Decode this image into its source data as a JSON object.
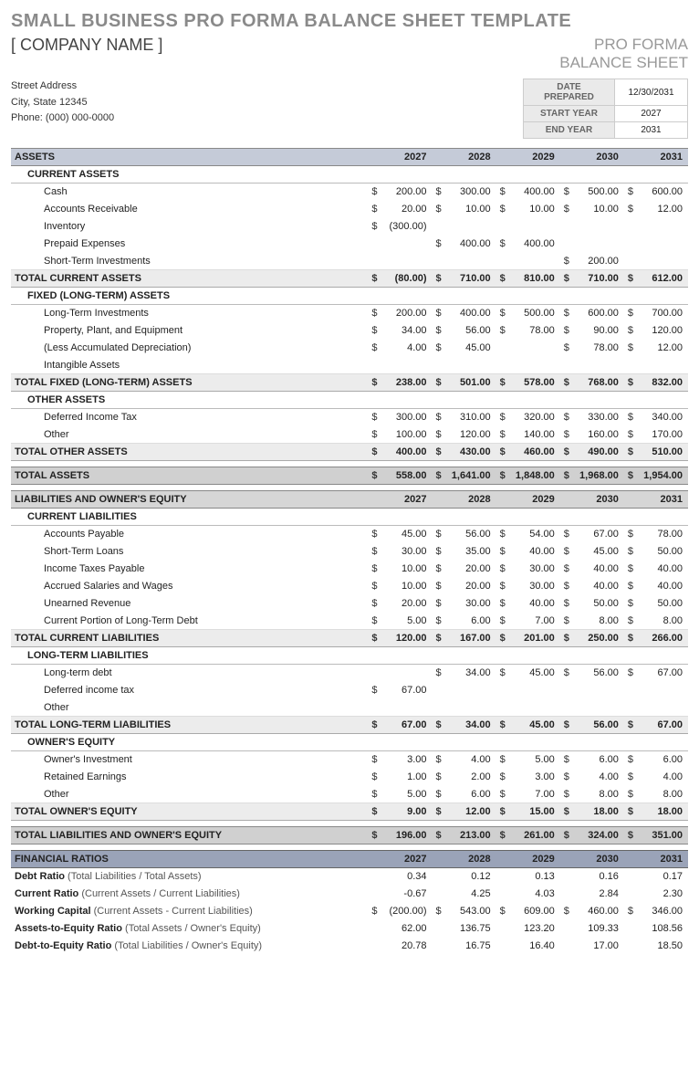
{
  "title": "SMALL BUSINESS PRO FORMA BALANCE SHEET TEMPLATE",
  "company": "[ COMPANY NAME ]",
  "proforma_l1": "PRO FORMA",
  "proforma_l2": "BALANCE SHEET",
  "address": {
    "street": "Street Address",
    "city": "City, State  12345",
    "phone": "Phone: (000) 000-0000"
  },
  "meta": {
    "date_label": "DATE PREPARED",
    "date_val": "12/30/2031",
    "start_label": "START YEAR",
    "start_val": "2027",
    "end_label": "END YEAR",
    "end_val": "2031"
  },
  "years": [
    "2027",
    "2028",
    "2029",
    "2030",
    "2031"
  ],
  "sections": {
    "assets": "ASSETS",
    "current_assets": "CURRENT ASSETS",
    "fixed_assets": "FIXED (LONG-TERM) ASSETS",
    "other_assets": "OTHER ASSETS",
    "liab_equity": "LIABILITIES AND OWNER'S EQUITY",
    "current_liab": "CURRENT LIABILITIES",
    "long_liab": "LONG-TERM LIABILITIES",
    "equity": "OWNER'S EQUITY",
    "fin": "FINANCIAL RATIOS"
  },
  "rows": {
    "cash": {
      "l": "Cash",
      "v": [
        "200.00",
        "300.00",
        "400.00",
        "500.00",
        "600.00"
      ]
    },
    "ar": {
      "l": "Accounts Receivable",
      "v": [
        "20.00",
        "10.00",
        "10.00",
        "10.00",
        "12.00"
      ]
    },
    "inv": {
      "l": "Inventory",
      "v": [
        "(300.00)",
        "",
        "",
        "",
        ""
      ]
    },
    "prepaid": {
      "l": "Prepaid Expenses",
      "v": [
        "",
        "400.00",
        "400.00",
        "",
        ""
      ]
    },
    "stinv": {
      "l": "Short-Term Investments",
      "v": [
        "",
        "",
        "",
        "200.00",
        ""
      ]
    },
    "tot_ca": {
      "l": "TOTAL CURRENT ASSETS",
      "v": [
        "(80.00)",
        "710.00",
        "810.00",
        "710.00",
        "612.00"
      ]
    },
    "ltinv": {
      "l": "Long-Term Investments",
      "v": [
        "200.00",
        "400.00",
        "500.00",
        "600.00",
        "700.00"
      ]
    },
    "ppe": {
      "l": "Property, Plant, and Equipment",
      "v": [
        "34.00",
        "56.00",
        "78.00",
        "90.00",
        "120.00"
      ]
    },
    "dep": {
      "l": "(Less Accumulated Depreciation)",
      "v": [
        "4.00",
        "45.00",
        "",
        "78.00",
        "12.00"
      ]
    },
    "intang": {
      "l": "Intangible Assets",
      "v": [
        "",
        "",
        "",
        "",
        ""
      ]
    },
    "tot_fa": {
      "l": "TOTAL FIXED (LONG-TERM) ASSETS",
      "v": [
        "238.00",
        "501.00",
        "578.00",
        "768.00",
        "832.00"
      ]
    },
    "dit": {
      "l": "Deferred Income Tax",
      "v": [
        "300.00",
        "310.00",
        "320.00",
        "330.00",
        "340.00"
      ]
    },
    "oth_a": {
      "l": "Other",
      "v": [
        "100.00",
        "120.00",
        "140.00",
        "160.00",
        "170.00"
      ]
    },
    "tot_oa": {
      "l": "TOTAL OTHER ASSETS",
      "v": [
        "400.00",
        "430.00",
        "460.00",
        "490.00",
        "510.00"
      ]
    },
    "tot_a": {
      "l": "TOTAL ASSETS",
      "v": [
        "558.00",
        "1,641.00",
        "1,848.00",
        "1,968.00",
        "1,954.00"
      ]
    },
    "ap": {
      "l": "Accounts Payable",
      "v": [
        "45.00",
        "56.00",
        "54.00",
        "67.00",
        "78.00"
      ]
    },
    "stl": {
      "l": "Short-Term Loans",
      "v": [
        "30.00",
        "35.00",
        "40.00",
        "45.00",
        "50.00"
      ]
    },
    "itp": {
      "l": "Income Taxes Payable",
      "v": [
        "10.00",
        "20.00",
        "30.00",
        "40.00",
        "40.00"
      ]
    },
    "asw": {
      "l": "Accrued Salaries and Wages",
      "v": [
        "10.00",
        "20.00",
        "30.00",
        "40.00",
        "40.00"
      ]
    },
    "ur": {
      "l": "Unearned Revenue",
      "v": [
        "20.00",
        "30.00",
        "40.00",
        "50.00",
        "50.00"
      ]
    },
    "cplt": {
      "l": "Current Portion of Long-Term Debt",
      "v": [
        "5.00",
        "6.00",
        "7.00",
        "8.00",
        "8.00"
      ]
    },
    "tot_cl": {
      "l": "TOTAL CURRENT LIABILITIES",
      "v": [
        "120.00",
        "167.00",
        "201.00",
        "250.00",
        "266.00"
      ]
    },
    "ltd": {
      "l": "Long-term debt",
      "v": [
        "",
        "34.00",
        "45.00",
        "56.00",
        "67.00"
      ]
    },
    "dit2": {
      "l": "Deferred income tax",
      "v": [
        "67.00",
        "",
        "",
        "",
        ""
      ]
    },
    "oth_l": {
      "l": "Other",
      "v": [
        "",
        "",
        "",
        "",
        ""
      ]
    },
    "tot_ll": {
      "l": "TOTAL LONG-TERM LIABILITIES",
      "v": [
        "67.00",
        "34.00",
        "45.00",
        "56.00",
        "67.00"
      ]
    },
    "oinv": {
      "l": "Owner's Investment",
      "v": [
        "3.00",
        "4.00",
        "5.00",
        "6.00",
        "6.00"
      ]
    },
    "ret": {
      "l": "Retained Earnings",
      "v": [
        "1.00",
        "2.00",
        "3.00",
        "4.00",
        "4.00"
      ]
    },
    "oth_e": {
      "l": "Other",
      "v": [
        "5.00",
        "6.00",
        "7.00",
        "8.00",
        "8.00"
      ]
    },
    "tot_oe": {
      "l": "TOTAL OWNER'S EQUITY",
      "v": [
        "9.00",
        "12.00",
        "15.00",
        "18.00",
        "18.00"
      ]
    },
    "tot_le": {
      "l": "TOTAL LIABILITIES AND OWNER'S EQUITY",
      "v": [
        "196.00",
        "213.00",
        "261.00",
        "324.00",
        "351.00"
      ]
    }
  },
  "ratios": {
    "debt": {
      "l": "Debt Ratio",
      "n": " (Total Liabilities / Total Assets)",
      "v": [
        "0.34",
        "0.12",
        "0.13",
        "0.16",
        "0.17"
      ],
      "d": false
    },
    "cur": {
      "l": "Current Ratio",
      "n": " (Current Assets / Current Liabilities)",
      "v": [
        "-0.67",
        "4.25",
        "4.03",
        "2.84",
        "2.30"
      ],
      "d": false
    },
    "wc": {
      "l": "Working Capital",
      "n": " (Current Assets - Current Liabilities)",
      "v": [
        "(200.00)",
        "543.00",
        "609.00",
        "460.00",
        "346.00"
      ],
      "d": true
    },
    "ae": {
      "l": "Assets-to-Equity Ratio",
      "n": " (Total Assets / Owner's Equity)",
      "v": [
        "62.00",
        "136.75",
        "123.20",
        "109.33",
        "108.56"
      ],
      "d": false
    },
    "de": {
      "l": "Debt-to-Equity Ratio",
      "n": " (Total Liabilities / Owner's Equity)",
      "v": [
        "20.78",
        "16.75",
        "16.40",
        "17.00",
        "18.50"
      ],
      "d": false
    }
  }
}
